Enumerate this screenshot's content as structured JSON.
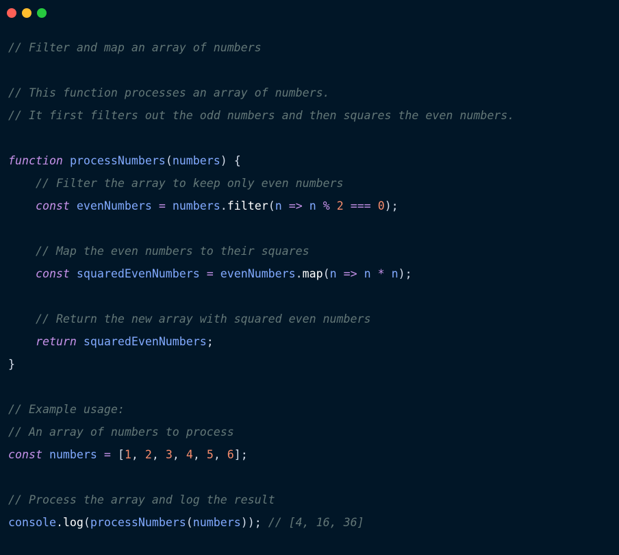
{
  "window": {
    "controls": [
      {
        "name": "close",
        "color": "#ff5f56"
      },
      {
        "name": "minimize",
        "color": "#ffbd2e"
      },
      {
        "name": "maximize",
        "color": "#27c93f"
      }
    ]
  },
  "theme": {
    "background": "#011627",
    "comment": "#637777",
    "keyword": "#c792ea",
    "identifier": "#82aaff",
    "number": "#f78c6c",
    "text": "#d6deeb"
  },
  "code": {
    "lines": [
      [
        {
          "t": "cm",
          "v": "// Filter and map an array of numbers"
        }
      ],
      [],
      [
        {
          "t": "cm",
          "v": "// This function processes an array of numbers."
        }
      ],
      [
        {
          "t": "cm",
          "v": "// It first filters out the odd numbers and then squares the even numbers."
        }
      ],
      [],
      [
        {
          "t": "kw",
          "v": "function"
        },
        {
          "t": "pn",
          "v": " "
        },
        {
          "t": "fn",
          "v": "processNumbers"
        },
        {
          "t": "pn",
          "v": "("
        },
        {
          "t": "id",
          "v": "numbers"
        },
        {
          "t": "pn",
          "v": ") {"
        }
      ],
      [
        {
          "t": "pn",
          "v": "    "
        },
        {
          "t": "cm",
          "v": "// Filter the array to keep only even numbers"
        }
      ],
      [
        {
          "t": "pn",
          "v": "    "
        },
        {
          "t": "kw",
          "v": "const"
        },
        {
          "t": "pn",
          "v": " "
        },
        {
          "t": "id",
          "v": "evenNumbers"
        },
        {
          "t": "pn",
          "v": " "
        },
        {
          "t": "op",
          "v": "="
        },
        {
          "t": "pn",
          "v": " "
        },
        {
          "t": "id",
          "v": "numbers"
        },
        {
          "t": "pn",
          "v": "."
        },
        {
          "t": "mth",
          "v": "filter"
        },
        {
          "t": "pn",
          "v": "("
        },
        {
          "t": "id",
          "v": "n"
        },
        {
          "t": "pn",
          "v": " "
        },
        {
          "t": "op",
          "v": "=>"
        },
        {
          "t": "pn",
          "v": " "
        },
        {
          "t": "id",
          "v": "n"
        },
        {
          "t": "pn",
          "v": " "
        },
        {
          "t": "op",
          "v": "%"
        },
        {
          "t": "pn",
          "v": " "
        },
        {
          "t": "num",
          "v": "2"
        },
        {
          "t": "pn",
          "v": " "
        },
        {
          "t": "op",
          "v": "==="
        },
        {
          "t": "pn",
          "v": " "
        },
        {
          "t": "num",
          "v": "0"
        },
        {
          "t": "pn",
          "v": ");"
        }
      ],
      [],
      [
        {
          "t": "pn",
          "v": "    "
        },
        {
          "t": "cm",
          "v": "// Map the even numbers to their squares"
        }
      ],
      [
        {
          "t": "pn",
          "v": "    "
        },
        {
          "t": "kw",
          "v": "const"
        },
        {
          "t": "pn",
          "v": " "
        },
        {
          "t": "id",
          "v": "squaredEvenNumbers"
        },
        {
          "t": "pn",
          "v": " "
        },
        {
          "t": "op",
          "v": "="
        },
        {
          "t": "pn",
          "v": " "
        },
        {
          "t": "id",
          "v": "evenNumbers"
        },
        {
          "t": "pn",
          "v": "."
        },
        {
          "t": "mth",
          "v": "map"
        },
        {
          "t": "pn",
          "v": "("
        },
        {
          "t": "id",
          "v": "n"
        },
        {
          "t": "pn",
          "v": " "
        },
        {
          "t": "op",
          "v": "=>"
        },
        {
          "t": "pn",
          "v": " "
        },
        {
          "t": "id",
          "v": "n"
        },
        {
          "t": "pn",
          "v": " "
        },
        {
          "t": "op",
          "v": "*"
        },
        {
          "t": "pn",
          "v": " "
        },
        {
          "t": "id",
          "v": "n"
        },
        {
          "t": "pn",
          "v": ");"
        }
      ],
      [],
      [
        {
          "t": "pn",
          "v": "    "
        },
        {
          "t": "cm",
          "v": "// Return the new array with squared even numbers"
        }
      ],
      [
        {
          "t": "pn",
          "v": "    "
        },
        {
          "t": "kw",
          "v": "return"
        },
        {
          "t": "pn",
          "v": " "
        },
        {
          "t": "id",
          "v": "squaredEvenNumbers"
        },
        {
          "t": "pn",
          "v": ";"
        }
      ],
      [
        {
          "t": "pn",
          "v": "}"
        }
      ],
      [],
      [
        {
          "t": "cm",
          "v": "// Example usage:"
        }
      ],
      [
        {
          "t": "cm",
          "v": "// An array of numbers to process"
        }
      ],
      [
        {
          "t": "kw",
          "v": "const"
        },
        {
          "t": "pn",
          "v": " "
        },
        {
          "t": "id",
          "v": "numbers"
        },
        {
          "t": "pn",
          "v": " "
        },
        {
          "t": "op",
          "v": "="
        },
        {
          "t": "pn",
          "v": " ["
        },
        {
          "t": "num",
          "v": "1"
        },
        {
          "t": "pn",
          "v": ", "
        },
        {
          "t": "num",
          "v": "2"
        },
        {
          "t": "pn",
          "v": ", "
        },
        {
          "t": "num",
          "v": "3"
        },
        {
          "t": "pn",
          "v": ", "
        },
        {
          "t": "num",
          "v": "4"
        },
        {
          "t": "pn",
          "v": ", "
        },
        {
          "t": "num",
          "v": "5"
        },
        {
          "t": "pn",
          "v": ", "
        },
        {
          "t": "num",
          "v": "6"
        },
        {
          "t": "pn",
          "v": "];"
        }
      ],
      [],
      [
        {
          "t": "cm",
          "v": "// Process the array and log the result"
        }
      ],
      [
        {
          "t": "id",
          "v": "console"
        },
        {
          "t": "pn",
          "v": "."
        },
        {
          "t": "mth",
          "v": "log"
        },
        {
          "t": "pn",
          "v": "("
        },
        {
          "t": "fn",
          "v": "processNumbers"
        },
        {
          "t": "pn",
          "v": "("
        },
        {
          "t": "id",
          "v": "numbers"
        },
        {
          "t": "pn",
          "v": ")); "
        },
        {
          "t": "cm",
          "v": "// [4, 16, 36]"
        }
      ]
    ]
  }
}
